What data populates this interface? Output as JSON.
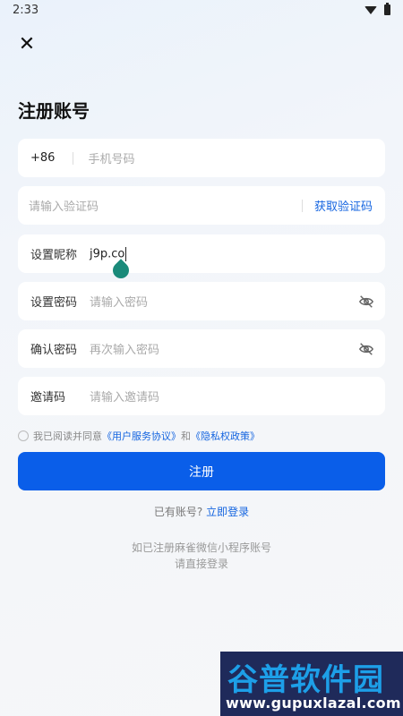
{
  "status_bar": {
    "time": "2:33"
  },
  "header": {
    "close_icon": "close-icon",
    "title": "注册账号"
  },
  "phone": {
    "country_code": "+86",
    "placeholder": "手机号码"
  },
  "code": {
    "placeholder": "请输入验证码",
    "get_code_label": "获取验证码"
  },
  "nickname": {
    "label": "设置昵称",
    "value": "j9p.co"
  },
  "password": {
    "label": "设置密码",
    "placeholder": "请输入密码",
    "toggle_icon": "eye-off-icon"
  },
  "confirm": {
    "label": "确认密码",
    "placeholder": "再次输入密码",
    "toggle_icon": "eye-off-icon"
  },
  "invite": {
    "label": "邀请码",
    "placeholder": "请输入邀请码"
  },
  "agreement": {
    "prefix": "我已阅读并同意",
    "user_agreement": "《用户服务协议》",
    "and": "和",
    "privacy": "《隐私权政策》"
  },
  "register_button": "注册",
  "login": {
    "prompt": "已有账号?",
    "link": "立即登录"
  },
  "hint": {
    "line1": "如已注册麻雀微信小程序账号",
    "line2": "请直接登录"
  },
  "watermark": {
    "main": "谷普软件园",
    "sub": "www.gupuxlazal.com"
  },
  "colors": {
    "primary": "#0a5ee9",
    "link": "#1565e0",
    "handle": "#1a8a7a"
  }
}
